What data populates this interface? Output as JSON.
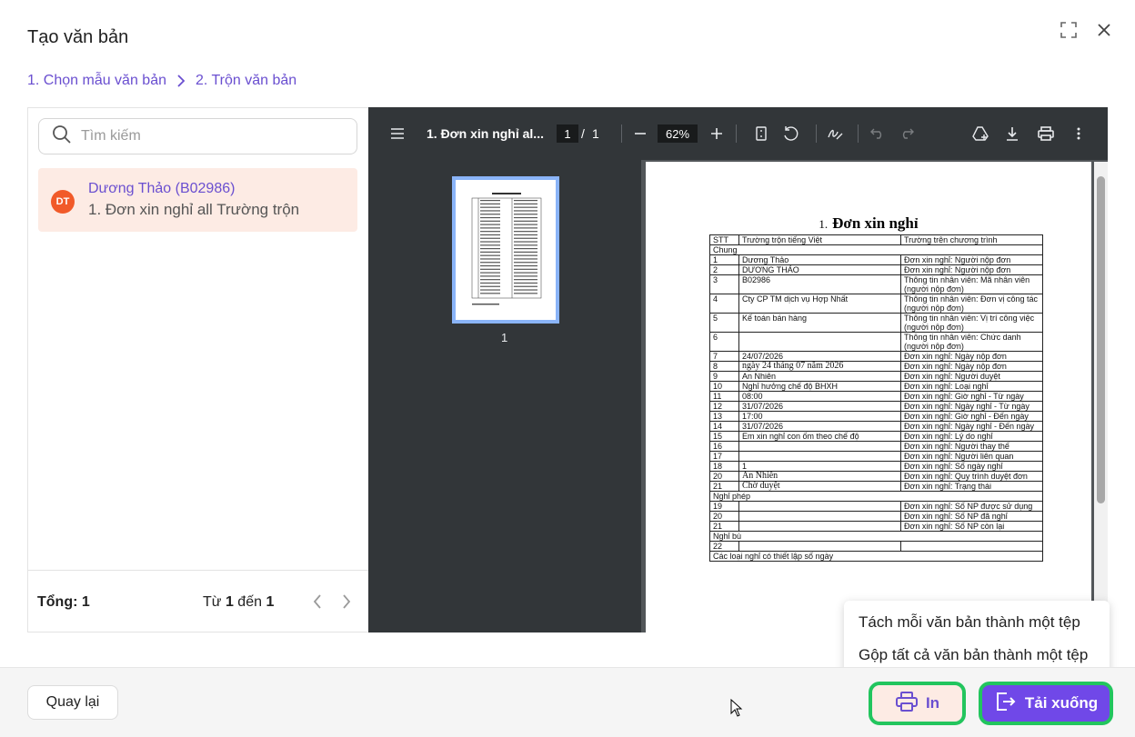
{
  "modal": {
    "title": "Tạo văn bản"
  },
  "breadcrumb": {
    "step1": "1. Chọn mẫu văn bản",
    "step2": "2. Trộn văn bản"
  },
  "search": {
    "placeholder": "Tìm kiếm"
  },
  "list": {
    "items": [
      {
        "avatar": "DT",
        "name": "Dương Thảo (B02986)",
        "subtitle": "1. Đơn xin nghỉ all Trường trộn"
      }
    ],
    "total_label": "Tổng: 1",
    "range_prefix": "Từ",
    "range_from": "1",
    "range_mid": "đến",
    "range_to": "1"
  },
  "viewer": {
    "doc_title": "1. Đơn xin nghỉ al...",
    "page_current": "1",
    "page_sep": "/",
    "page_total": "1",
    "zoom": "62%",
    "thumb_label": "1"
  },
  "document": {
    "title_num": "1.",
    "title": "Đơn xin nghỉ",
    "headers": [
      "STT",
      "Trường trộn tiếng Việt",
      "Trường trên chương trình"
    ],
    "rows": [
      {
        "section": "Chung"
      },
      {
        "c1": "1",
        "c2": "Dương Thảo",
        "c3": "Đơn xin nghỉ: Người nộp đơn"
      },
      {
        "c1": "2",
        "c2": "DƯƠNG THẢO",
        "c3": "Đơn xin nghỉ: Người nộp đơn"
      },
      {
        "c1": "3",
        "c2": "B02986",
        "c3": "Thông tin nhân viên: Mã nhân viên (người nộp đơn)"
      },
      {
        "c1": "4",
        "c2": "Cty CP TM dịch vụ Hợp Nhất",
        "c3": "Thông tin nhân viên: Đơn vị công tác (người nộp đơn)"
      },
      {
        "c1": "5",
        "c2": "Kế toán bán hàng",
        "c3": "Thông tin nhân viên: Vị trí công việc (người nộp đơn)"
      },
      {
        "c1": "6",
        "c2": "",
        "c3": "Thông tin nhân viên: Chức danh (người nộp đơn)"
      },
      {
        "c1": "7",
        "c2": "24/07/2026",
        "c3": "Đơn xin nghỉ: Ngày nộp đơn"
      },
      {
        "c1": "8",
        "c2": "ngày 24 tháng 07 năm 2026",
        "c3": "Đơn xin nghỉ: Ngày nộp đơn",
        "serif": true
      },
      {
        "c1": "9",
        "c2": "An Nhiên",
        "c3": "Đơn xin nghỉ: Người duyệt"
      },
      {
        "c1": "10",
        "c2": "Nghỉ hưởng chế độ BHXH",
        "c3": "Đơn xin nghỉ: Loại nghỉ"
      },
      {
        "c1": "11",
        "c2": "08:00",
        "c3": "Đơn xin nghỉ: Giờ nghỉ - Từ ngày"
      },
      {
        "c1": "12",
        "c2": "31/07/2026",
        "c3": "Đơn xin nghỉ: Ngày nghỉ - Từ ngày"
      },
      {
        "c1": "13",
        "c2": "17:00",
        "c3": "Đơn xin nghỉ: Giờ nghỉ - Đến ngày"
      },
      {
        "c1": "14",
        "c2": "31/07/2026",
        "c3": "Đơn xin nghỉ: Ngày nghỉ - Đến ngày"
      },
      {
        "c1": "15",
        "c2": "Em xin nghỉ con ốm theo chế độ",
        "c3": "Đơn xin nghỉ: Lý do nghỉ"
      },
      {
        "c1": "16",
        "c2": "",
        "c3": "Đơn xin nghỉ: Người thay thế"
      },
      {
        "c1": "17",
        "c2": "",
        "c3": "Đơn xin nghỉ: Người liên quan"
      },
      {
        "c1": "18",
        "c2": "1",
        "c3": "Đơn xin nghỉ: Số ngày nghỉ"
      },
      {
        "c1": "20",
        "c2": "An Nhiên",
        "c3": "Đơn xin nghỉ: Quy trình duyệt đơn",
        "serif": true
      },
      {
        "c1": "21",
        "c2": "Chờ duyệt",
        "c3": "Đơn xin nghỉ: Trạng thái",
        "serif": true
      },
      {
        "section": "Nghỉ phép"
      },
      {
        "c1": "19",
        "c2": "",
        "c3": "Đơn xin nghỉ: Số NP được sử dụng"
      },
      {
        "c1": "20",
        "c2": "",
        "c3": "Đơn xin nghỉ: Số NP đã nghỉ"
      },
      {
        "c1": "21",
        "c2": "",
        "c3": "Đơn xin nghỉ: Số NP còn lại"
      },
      {
        "section": "Nghỉ bù"
      },
      {
        "c1": "22",
        "c2": "",
        "c3": ""
      },
      {
        "section": "Các loại nghỉ có thiết lập số ngày"
      }
    ]
  },
  "dropdown": {
    "items": [
      "Tách mỗi văn bản thành một tệp",
      "Gộp tất cả văn bản thành một tệp"
    ]
  },
  "footer": {
    "back_label": "Quay lại",
    "print_label": "In",
    "download_label": "Tải xuống"
  },
  "colors": {
    "accent": "#6a4fd0",
    "primary_button": "#7048e8",
    "highlight_outline": "#22c55e",
    "selected_row": "#fdebe4",
    "avatar": "#f15a29"
  }
}
